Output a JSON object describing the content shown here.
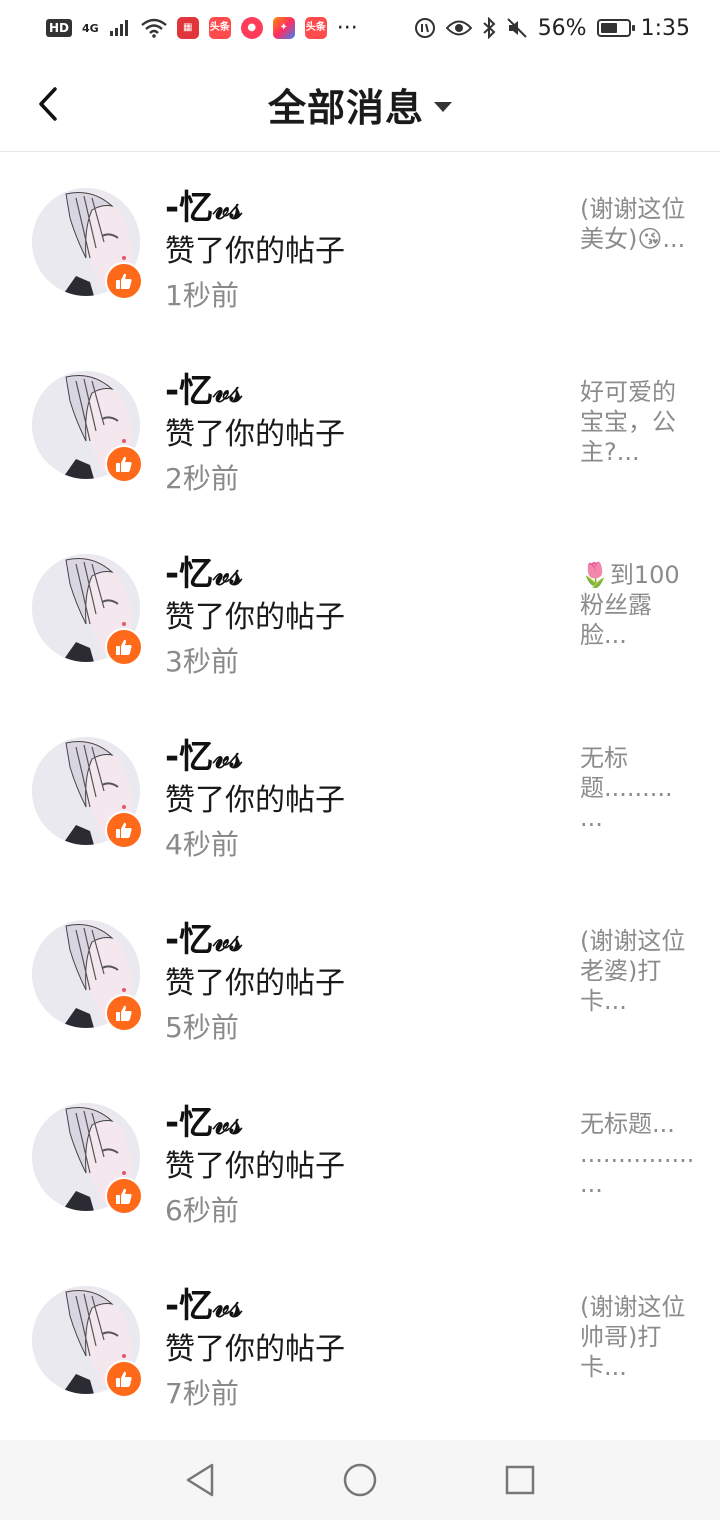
{
  "status_bar": {
    "hd": "HD",
    "network": "4G",
    "app_icons": [
      "toutiao-news-icon",
      "toutiao-news-icon-2",
      "app-icon-red",
      "app-icon-colorful",
      "toutiao-icon-3"
    ],
    "toutiao_label": "头条",
    "more": "···",
    "battery": "56%",
    "time": "1:35"
  },
  "header": {
    "back_icon": "chevron-left-icon",
    "title": "全部消息",
    "dropdown_icon": "caret-down-icon"
  },
  "notifications": [
    {
      "name": "-忆𝓋𝓈",
      "action": "赞了你的帖子",
      "time": "1秒前",
      "preview": "(谢谢这位美女)😘..."
    },
    {
      "name": "-忆𝓋𝓈",
      "action": "赞了你的帖子",
      "time": "2秒前",
      "preview": "好可爱的宝宝，公主?..."
    },
    {
      "name": "-忆𝓋𝓈",
      "action": "赞了你的帖子",
      "time": "3秒前",
      "preview": "🌷到100粉丝露脸..."
    },
    {
      "name": "-忆𝓋𝓈",
      "action": "赞了你的帖子",
      "time": "4秒前",
      "preview": "无标题.........\n..."
    },
    {
      "name": "-忆𝓋𝓈",
      "action": "赞了你的帖子",
      "time": "5秒前",
      "preview": "(谢谢这位老婆)打卡..."
    },
    {
      "name": "-忆𝓋𝓈",
      "action": "赞了你的帖子",
      "time": "6秒前",
      "preview": "无标题...\n...............\n..."
    },
    {
      "name": "-忆𝓋𝓈",
      "action": "赞了你的帖子",
      "time": "7秒前",
      "preview": "(谢谢这位帅哥)打卡..."
    }
  ],
  "colors": {
    "like_badge": "#ff6a1a",
    "muted_text": "#8c8c8c"
  },
  "nav_bar": {
    "back": "triangle-back-icon",
    "home": "circle-home-icon",
    "recents": "square-recents-icon"
  }
}
